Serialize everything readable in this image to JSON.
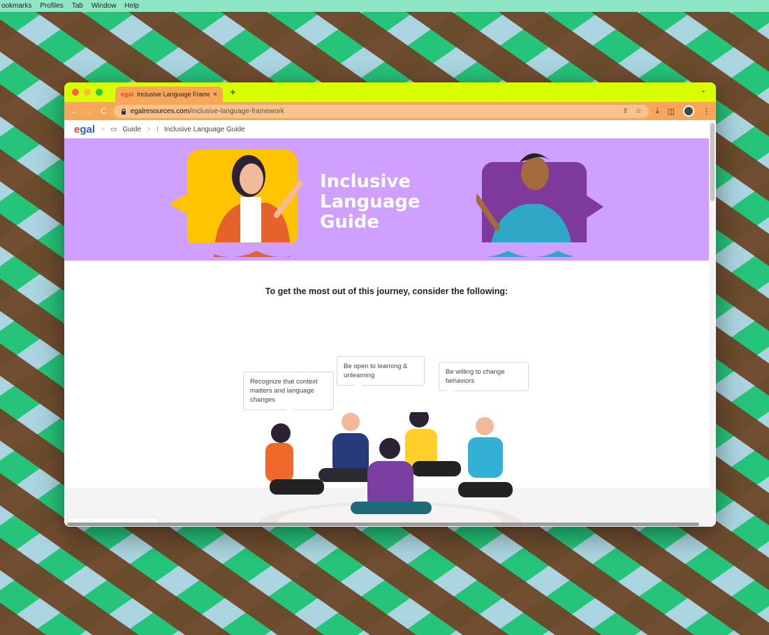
{
  "os_menu": [
    "ookmarks",
    "Profiles",
    "Tab",
    "Window",
    "Help"
  ],
  "browser": {
    "tab": {
      "favicon": "egal",
      "title": "Inclusive Language Framewor",
      "close": "×"
    },
    "new_tab": "+",
    "chevron": "⌄",
    "nav": {
      "back": "←",
      "forward": "→",
      "reload": "C"
    },
    "url": {
      "host": "egalresources.com",
      "path": "/inclusive-language-framework"
    },
    "omni_icons": {
      "share": "⇧",
      "star": "☆"
    },
    "toolbar_icons": {
      "download": "⤓",
      "sidebar": "◫",
      "menu": "⋮"
    }
  },
  "page": {
    "breadcrumb": {
      "logo_e": "e",
      "logo_gal": "gal",
      "sep": ">",
      "guide_icon": "▭",
      "guide": "Guide",
      "current_icon": "⁝",
      "current": "Inclusive Language Guide"
    },
    "hero": {
      "title_lines": [
        "Inclusive",
        "Language",
        "Guide"
      ]
    },
    "intro": "To get the most out of this journey, consider the following:",
    "tips": [
      "Recognize that context matters and language changes",
      "Be open to learning & unlearning",
      "Be willing to change behaviors"
    ]
  },
  "colors": {
    "tab_bar": "#d8ff00",
    "toolbar": "#f7a65a",
    "hero_bg": "#cfa0ff",
    "bubble_yellow": "#ffc400",
    "bubble_purple": "#7e3a9a"
  }
}
